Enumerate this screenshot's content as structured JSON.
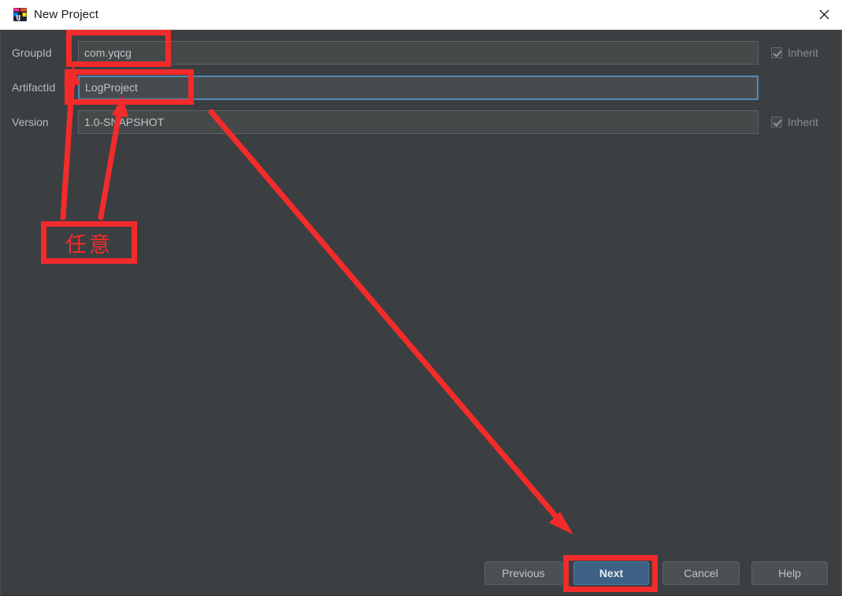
{
  "window": {
    "title": "New Project",
    "app_icon": "intellij-idea-icon",
    "close_icon": "close-icon"
  },
  "form": {
    "fields": [
      {
        "label": "GroupId",
        "value": "com.yqcg",
        "placeholder": "",
        "focused": false,
        "inherit": {
          "label": "Inherit",
          "checked": true,
          "enabled": false
        }
      },
      {
        "label": "ArtifactId",
        "value": "LogProject",
        "placeholder": "",
        "focused": true,
        "inherit": null
      },
      {
        "label": "Version",
        "value": "1.0-SNAPSHOT",
        "placeholder": "",
        "focused": false,
        "inherit": {
          "label": "Inherit",
          "checked": true,
          "enabled": false
        }
      }
    ]
  },
  "footer": {
    "buttons": [
      {
        "label": "Previous",
        "primary": false
      },
      {
        "label": "Next",
        "primary": true
      },
      {
        "label": "Cancel",
        "primary": false
      },
      {
        "label": "Help",
        "primary": false
      }
    ]
  },
  "annotations": {
    "color": "#f32b2b",
    "note_text": "任意",
    "boxes": [
      {
        "name": "groupid-highlight"
      },
      {
        "name": "artifactid-highlight"
      },
      {
        "name": "note-highlight"
      },
      {
        "name": "next-button-highlight"
      }
    ]
  },
  "colors": {
    "dialog_background": "#3c3f41",
    "titlebar_background": "#ffffff",
    "input_background": "#45494a",
    "focus_border": "#5687b5",
    "primary_button": "#3d6185",
    "annotation_red": "#f32b2b",
    "label_text": "#b8bcbd"
  }
}
